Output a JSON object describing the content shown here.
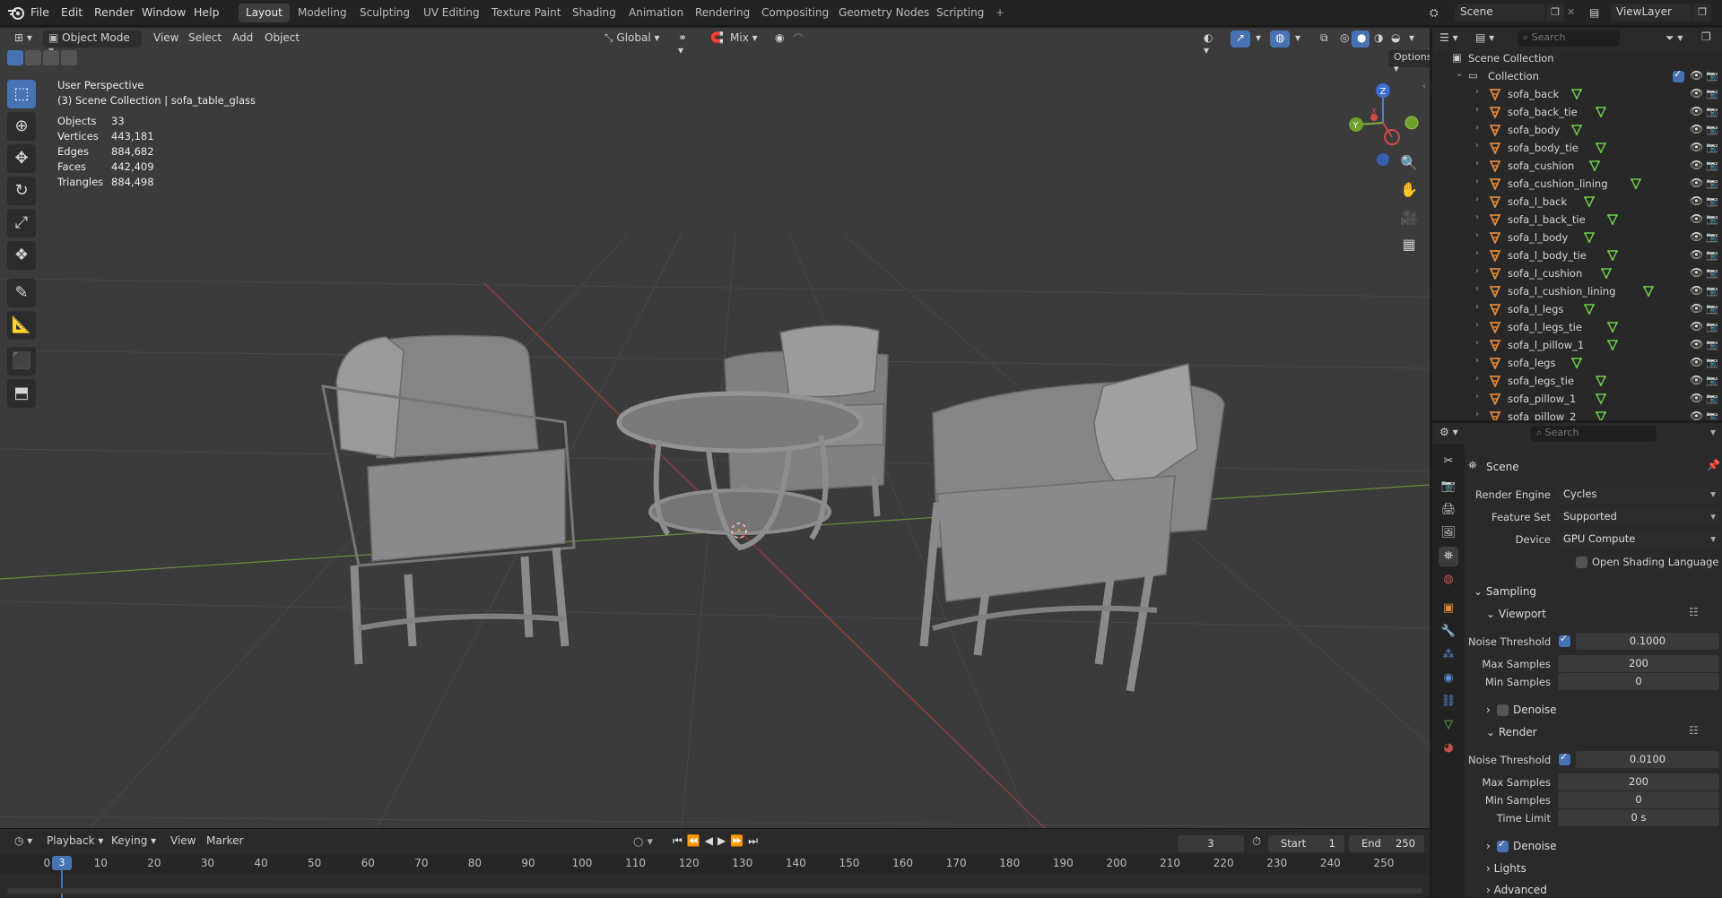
{
  "topbar": {
    "menus": [
      "File",
      "Edit",
      "Render",
      "Window",
      "Help"
    ],
    "workspaces": [
      "Layout",
      "Modeling",
      "Sculpting",
      "UV Editing",
      "Texture Paint",
      "Shading",
      "Animation",
      "Rendering",
      "Compositing",
      "Geometry Nodes",
      "Scripting"
    ],
    "active_workspace": "Layout",
    "add_tab": "+",
    "scene_name": "Scene",
    "view_layer": "ViewLayer"
  },
  "viewport_header": {
    "mode": "Object Mode",
    "menus": [
      "View",
      "Select",
      "Add",
      "Object"
    ],
    "orientation": "Global",
    "snap_mode": "Mix",
    "options": "Options"
  },
  "overlay": {
    "perspective": "User Perspective",
    "collection_path": "(3) Scene Collection | sofa_table_glass",
    "stats": [
      {
        "label": "Objects",
        "value": "33"
      },
      {
        "label": "Vertices",
        "value": "443,181"
      },
      {
        "label": "Edges",
        "value": "884,682"
      },
      {
        "label": "Faces",
        "value": "442,409"
      },
      {
        "label": "Triangles",
        "value": "884,498"
      }
    ]
  },
  "gizmo": {
    "z": "Z",
    "y": "Y",
    "x": "X"
  },
  "timeline": {
    "menus": [
      "Playback",
      "Keying",
      "View",
      "Marker"
    ],
    "current_frame": "3",
    "start_label": "Start",
    "start": "1",
    "end_label": "End",
    "end": "250",
    "ticks": [
      "0",
      "10",
      "20",
      "30",
      "40",
      "50",
      "60",
      "70",
      "80",
      "90",
      "100",
      "110",
      "120",
      "130",
      "140",
      "150",
      "160",
      "170",
      "180",
      "190",
      "200",
      "210",
      "220",
      "230",
      "240",
      "250"
    ]
  },
  "outliner": {
    "search_placeholder": "Search",
    "scene_collection": "Scene Collection",
    "collection": "Collection",
    "items": [
      "sofa_back",
      "sofa_back_tie",
      "sofa_body",
      "sofa_body_tie",
      "sofa_cushion",
      "sofa_cushion_lining",
      "sofa_l_back",
      "sofa_l_back_tie",
      "sofa_l_body",
      "sofa_l_body_tie",
      "sofa_l_cushion",
      "sofa_l_cushion_lining",
      "sofa_l_legs",
      "sofa_l_legs_tie",
      "sofa_l_pillow_1",
      "sofa_legs",
      "sofa_legs_tie",
      "sofa_pillow_1",
      "sofa_pillow_2"
    ]
  },
  "properties": {
    "search_placeholder": "Search",
    "context": "Scene",
    "render_engine_label": "Render Engine",
    "render_engine": "Cycles",
    "feature_set_label": "Feature Set",
    "feature_set": "Supported",
    "device_label": "Device",
    "device": "GPU Compute",
    "osl_label": "Open Shading Language",
    "sampling": "Sampling",
    "viewport": "Viewport",
    "vp_noise_label": "Noise Threshold",
    "vp_noise": "0.1000",
    "vp_max_label": "Max Samples",
    "vp_max": "200",
    "vp_min_label": "Min Samples",
    "vp_min": "0",
    "vp_denoise": "Denoise",
    "render": "Render",
    "r_noise_label": "Noise Threshold",
    "r_noise": "0.0100",
    "r_max_label": "Max Samples",
    "r_max": "200",
    "r_min_label": "Min Samples",
    "r_min": "0",
    "r_time_label": "Time Limit",
    "r_time": "0 s",
    "r_denoise": "Denoise",
    "lights": "Lights",
    "advanced": "Advanced"
  }
}
